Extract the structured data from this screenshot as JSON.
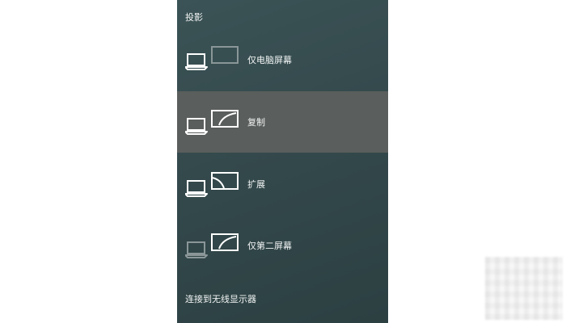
{
  "panel": {
    "title": "投影",
    "options": [
      {
        "label": "仅电脑屏幕",
        "icon": "pc-screen-only-icon",
        "selected": false
      },
      {
        "label": "复制",
        "icon": "duplicate-icon",
        "selected": true
      },
      {
        "label": "扩展",
        "icon": "extend-icon",
        "selected": false
      },
      {
        "label": "仅第二屏幕",
        "icon": "second-screen-only-icon",
        "selected": false
      }
    ],
    "wireless_link": "连接到无线显示器"
  },
  "colors": {
    "panel_bg": "#34494c",
    "selected_bg": "#5a5e5c",
    "text": "#f2f4f4"
  }
}
